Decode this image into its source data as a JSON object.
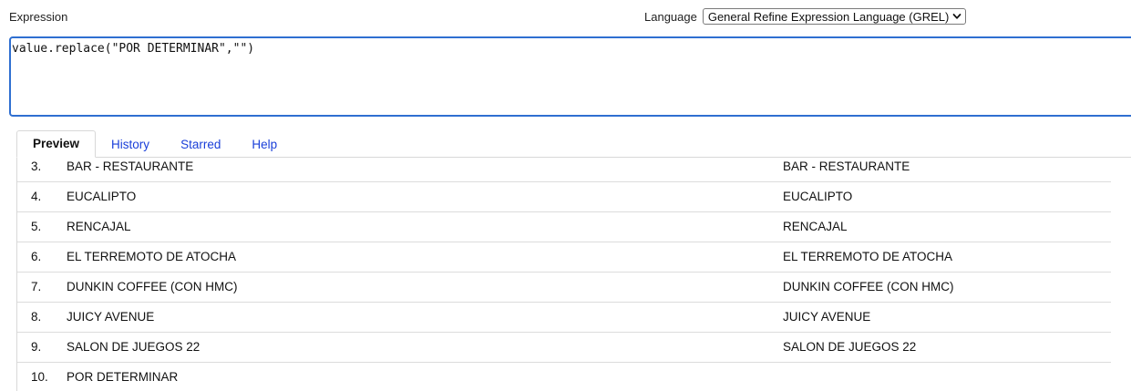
{
  "expression": {
    "label": "Expression",
    "value": "value.replace(\"POR DETERMINAR\",\"\")"
  },
  "language": {
    "label": "Language",
    "selected": "General Refine Expression Language (GREL)"
  },
  "tabs": [
    {
      "label": "Preview",
      "active": true
    },
    {
      "label": "History",
      "active": false
    },
    {
      "label": "Starred",
      "active": false
    },
    {
      "label": "Help",
      "active": false
    }
  ],
  "preview": {
    "rows": [
      {
        "index": "3.",
        "original": "BAR - RESTAURANTE",
        "result": "BAR - RESTAURANTE"
      },
      {
        "index": "4.",
        "original": "EUCALIPTO",
        "result": "EUCALIPTO"
      },
      {
        "index": "5.",
        "original": "RENCAJAL",
        "result": "RENCAJAL"
      },
      {
        "index": "6.",
        "original": "EL TERREMOTO DE ATOCHA",
        "result": "EL TERREMOTO DE ATOCHA"
      },
      {
        "index": "7.",
        "original": "DUNKIN COFFEE (CON HMC)",
        "result": "DUNKIN COFFEE (CON HMC)"
      },
      {
        "index": "8.",
        "original": "JUICY AVENUE",
        "result": "JUICY AVENUE"
      },
      {
        "index": "9.",
        "original": "SALON DE JUEGOS 22",
        "result": "SALON DE JUEGOS 22"
      },
      {
        "index": "10.",
        "original": "POR DETERMINAR",
        "result": ""
      }
    ]
  },
  "colors": {
    "focus_border": "#2f6fd1",
    "tab_link": "#1a3fd9",
    "row_divider": "#dcdcdc"
  }
}
